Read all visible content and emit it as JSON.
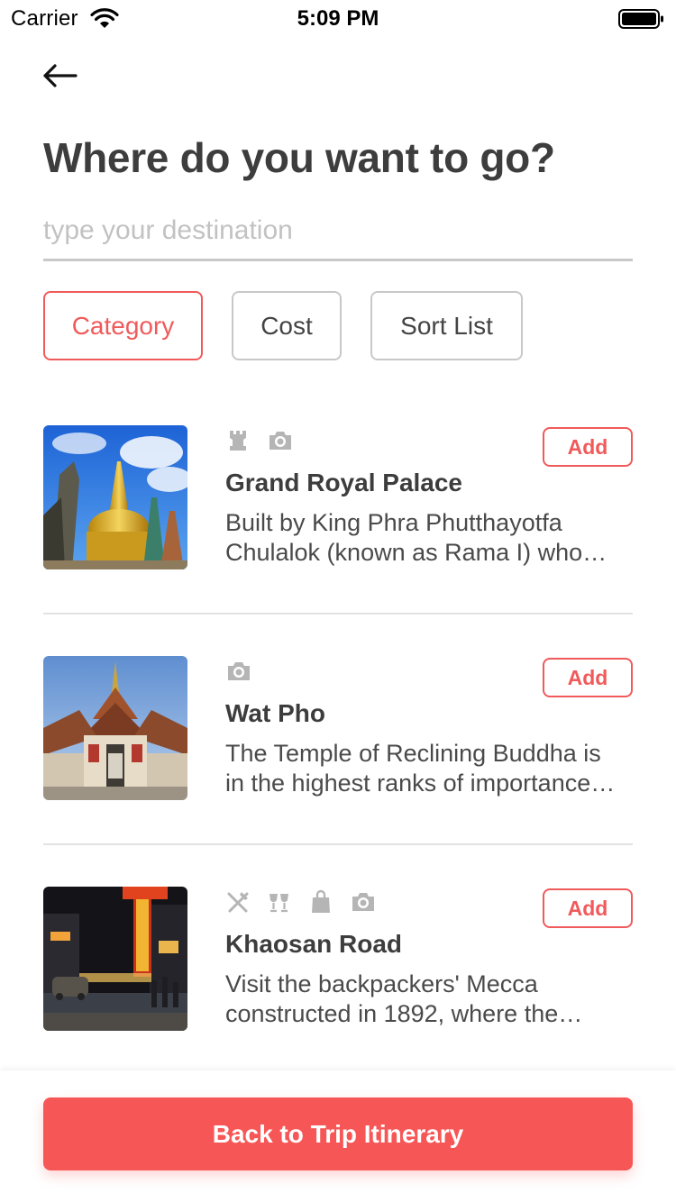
{
  "status_bar": {
    "carrier": "Carrier",
    "time": "5:09 PM",
    "icons": [
      "wifi-icon",
      "battery-icon"
    ]
  },
  "header": {
    "back_icon": "arrow-left-icon",
    "title": "Where do you want to go?"
  },
  "search": {
    "placeholder": "type your destination",
    "value": ""
  },
  "filters": {
    "category": "Category",
    "cost": "Cost",
    "sort": "Sort List",
    "active": "Category"
  },
  "places": [
    {
      "title": "Grand Royal Palace",
      "description": "Built by King Phra Phutthayotfa Chulalok (known as Rama I) who moved the capital here",
      "icons": [
        "chess-rook-icon",
        "camera-icon"
      ],
      "add_label": "Add"
    },
    {
      "title": "Wat Pho",
      "description": "The Temple of Reclining Buddha is in the highest ranks of importance among temples",
      "icons": [
        "camera-icon"
      ],
      "add_label": "Add"
    },
    {
      "title": "Khaosan Road",
      "description": "Visit the backpackers' Mecca constructed in 1892, where the tourists gather",
      "icons": [
        "fork-knife-icon",
        "wine-glasses-icon",
        "shopping-bag-icon",
        "camera-icon"
      ],
      "add_label": "Add"
    }
  ],
  "bottom": {
    "button_label": "Back to Trip Itinerary"
  },
  "colors": {
    "accent": "#f05a5a",
    "primary_button": "#f75656",
    "icon_gray": "#b5b5b5",
    "divider": "#e2e2e2"
  }
}
